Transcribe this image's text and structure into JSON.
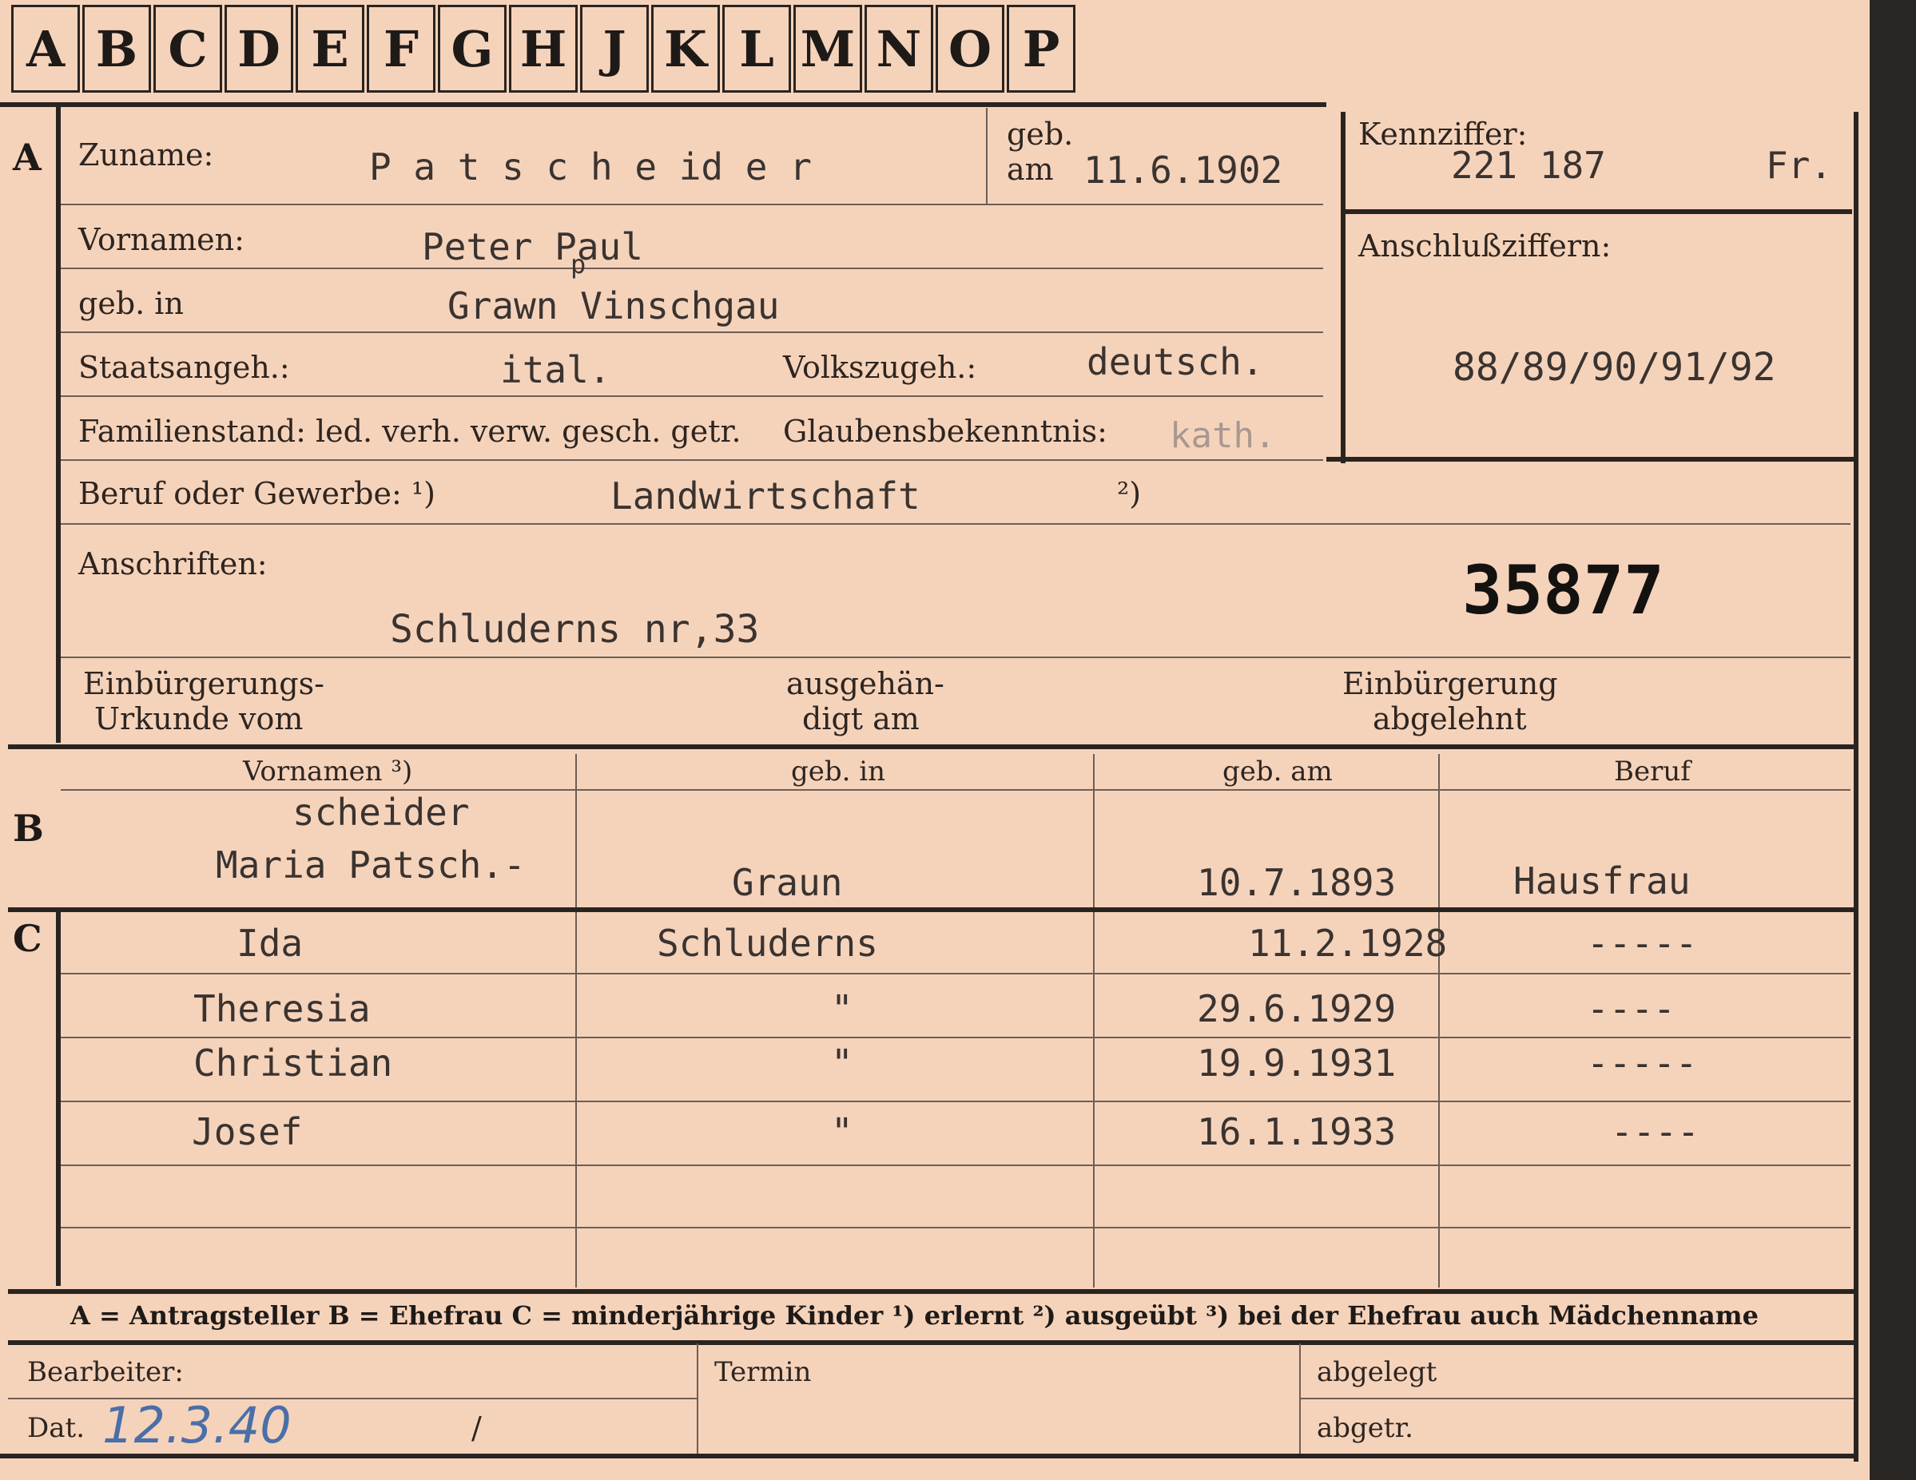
{
  "tabs": [
    "A",
    "B",
    "C",
    "D",
    "E",
    "F",
    "G",
    "H",
    "J",
    "K",
    "L",
    "M",
    "N",
    "O",
    "P"
  ],
  "sections": {
    "a": "A",
    "b": "B",
    "c": "C"
  },
  "applicant": {
    "surname_label": "Zuname:",
    "surname": "P a t s c h e id e r",
    "geb_label": "geb.",
    "am_label": "am",
    "birth_date": "11.6.1902",
    "vornamen_label": "Vornamen:",
    "vornamen": "Peter Paul",
    "vornamen_correction": "p",
    "geb_in_label": "geb. in",
    "birthplace": "Grawn  Vinschgau",
    "staat_label": "Staatsangeh.:",
    "staat": "ital.",
    "volk_label": "Volkszugeh.:",
    "volk": "deutsch.",
    "familienstand_label": "Familienstand: led. verh. verw. gesch. getr.",
    "glauben_label": "Glaubensbekenntnis:",
    "glauben": "kath.",
    "beruf_label": "Beruf oder Gewerbe: ¹)",
    "beruf": "Landwirtschaft",
    "beruf_note2": "²)",
    "anschriften_label": "Anschriften:",
    "anschrift": "Schluderns nr,33",
    "stamp_number": "35877",
    "einb_label_1": "Einbürgerungs-",
    "einb_label_2": "Urkunde vom",
    "ausgeh_label_1": "ausgehän-",
    "ausgeh_label_2": "digt am",
    "abgelehnt_label_1": "Einbürgerung",
    "abgelehnt_label_2": "abgelehnt"
  },
  "kennziffer": {
    "label": "Kennziffer:",
    "number": "221 187",
    "suffix": "Fr.",
    "anschluss_label": "Anschlußziffern:",
    "anschluss": "88/89/90/91/92"
  },
  "table_headers": {
    "vornamen": "Vornamen ³)",
    "geb_in": "geb. in",
    "geb_am": "geb. am",
    "beruf": "Beruf"
  },
  "spouse": {
    "name_line1": "scheider",
    "name_line2": "Maria Patsch.-",
    "place": "Graun",
    "date": "10.7.1893",
    "beruf": "Hausfrau"
  },
  "children": [
    {
      "name": "Ida",
      "place": "Schluderns",
      "date": "11.2.1928",
      "beruf": "-----"
    },
    {
      "name": "Theresia",
      "place": "\"",
      "date": "29.6.1929",
      "beruf": "----"
    },
    {
      "name": "Christian",
      "place": "\"",
      "date": "19.9.1931",
      "beruf": "-----"
    },
    {
      "name": "Josef",
      "place": "\"",
      "date": "16.1.1933",
      "beruf": "----"
    }
  ],
  "legend": "A = Antragsteller   B = Ehefrau   C = minderjährige Kinder   ¹) erlernt   ²) ausgeübt   ³) bei der Ehefrau auch Mädchenname",
  "footer": {
    "bearbeiter_label": "Bearbeiter:",
    "dat_label": "Dat.",
    "dat_value": "12.3.40",
    "slash": "/",
    "termin_label": "Termin",
    "abgelegt_label": "abgelegt",
    "abgetr_label": "abgetr."
  },
  "colors": {
    "card": "#f5d3bb",
    "ink": "#2e2520",
    "pencil": "#4a6fa8"
  }
}
